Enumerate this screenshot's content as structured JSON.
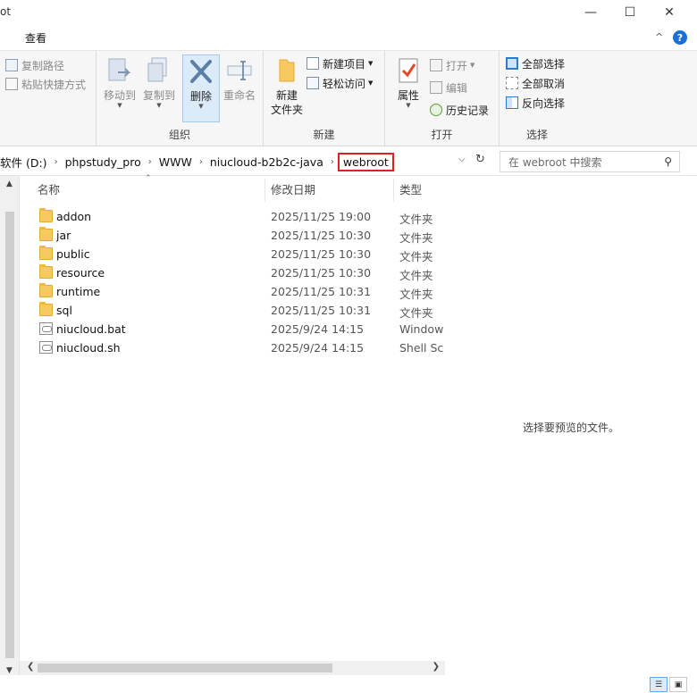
{
  "window": {
    "title_fragment": "ot",
    "minimize": "—",
    "maximize": "☐",
    "close": "✕"
  },
  "ribbon": {
    "active_tab": "查看",
    "collapse_glyph": "^",
    "help_glyph": "?",
    "clipboard": {
      "copy_path": "复制路径",
      "paste_shortcut": "粘贴快捷方式"
    },
    "organize": {
      "label": "组织",
      "move_to": "移动到",
      "copy_to": "复制到",
      "delete": "删除",
      "rename": "重命名"
    },
    "new": {
      "label": "新建",
      "new_folder": "新建\n文件夹",
      "new_item": "新建项目",
      "easy_access": "轻松访问"
    },
    "open": {
      "label": "打开",
      "properties": "属性",
      "open": "打开",
      "edit": "编辑",
      "history": "历史记录"
    },
    "select": {
      "label": "选择",
      "select_all": "全部选择",
      "select_none": "全部取消",
      "invert": "反向选择"
    }
  },
  "address": {
    "crumbs": [
      "软件 (D:)",
      "phpstudy_pro",
      "WWW",
      "niucloud-b2b2c-java"
    ],
    "current": "webroot",
    "separator": "›",
    "search_placeholder": "在 webroot 中搜索"
  },
  "filelist": {
    "columns": {
      "name": "名称",
      "date": "修改日期",
      "type": "类型"
    },
    "rows": [
      {
        "name": "addon",
        "date": "2025/11/25 19:00",
        "type": "文件夹",
        "icon": "folder-icon"
      },
      {
        "name": "jar",
        "date": "2025/11/25 10:30",
        "type": "文件夹",
        "icon": "folder-icon"
      },
      {
        "name": "public",
        "date": "2025/11/25 10:30",
        "type": "文件夹",
        "icon": "folder-icon"
      },
      {
        "name": "resource",
        "date": "2025/11/25 10:30",
        "type": "文件夹",
        "icon": "folder-icon"
      },
      {
        "name": "runtime",
        "date": "2025/11/25 10:31",
        "type": "文件夹",
        "icon": "folder-icon"
      },
      {
        "name": "sql",
        "date": "2025/11/25 10:31",
        "type": "文件夹",
        "icon": "folder-icon"
      },
      {
        "name": "niucloud.bat",
        "date": "2025/9/24 14:15",
        "type": "Windows",
        "icon": "script-icon"
      },
      {
        "name": "niucloud.sh",
        "date": "2025/9/24 14:15",
        "type": "Shell Scr",
        "icon": "script-icon"
      }
    ]
  },
  "preview": {
    "empty_text": "选择要预览的文件。"
  },
  "colors": {
    "highlight_border": "#e02020",
    "accent": "#1a6fd6"
  }
}
